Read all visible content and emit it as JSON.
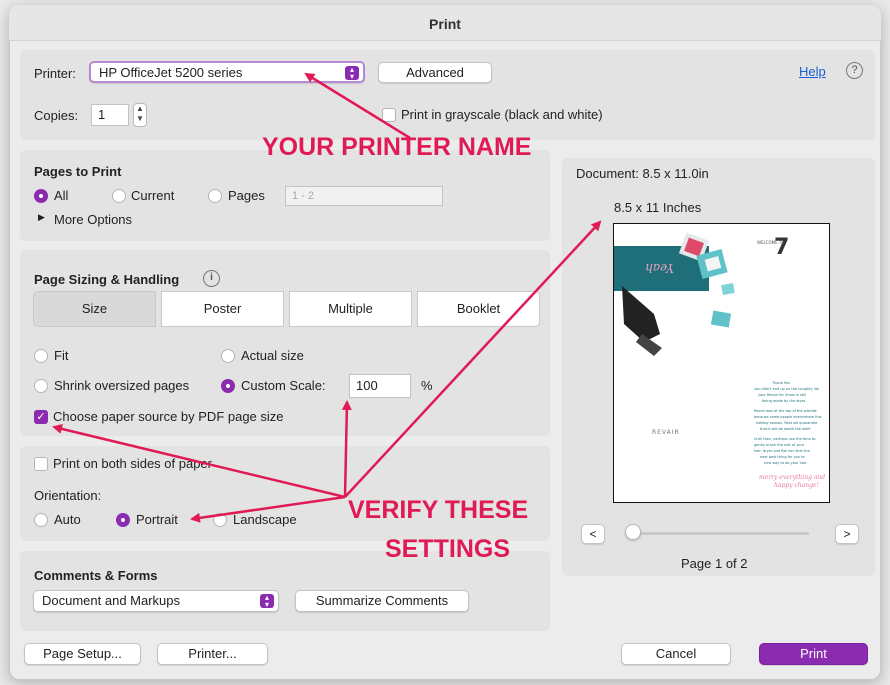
{
  "window": {
    "title": "Print"
  },
  "printer": {
    "label": "Printer:",
    "selected": "HP OfficeJet 5200 series",
    "advanced_label": "Advanced",
    "help_label": "Help",
    "help_icon": "?"
  },
  "copies": {
    "label": "Copies:",
    "value": "1",
    "grayscale_label": "Print in grayscale (black and white)",
    "grayscale_checked": false
  },
  "pages_to_print": {
    "title": "Pages to Print",
    "all_label": "All",
    "current_label": "Current",
    "pages_label": "Pages",
    "pages_placeholder": "1 - 2",
    "selected": "All",
    "more_options_label": "More Options"
  },
  "page_sizing": {
    "title": "Page Sizing & Handling",
    "info_icon": "i",
    "tabs": [
      "Size",
      "Poster",
      "Multiple",
      "Booklet"
    ],
    "selected_tab": "Size",
    "fit_label": "Fit",
    "actual_size_label": "Actual size",
    "shrink_label": "Shrink oversized pages",
    "custom_scale_label": "Custom Scale:",
    "custom_scale_value": "100",
    "percent_label": "%",
    "selected_option": "Custom Scale",
    "paper_source_label": "Choose paper source by PDF page size",
    "paper_source_checked": true
  },
  "duplex": {
    "both_sides_label": "Print on both sides of paper",
    "both_sides_checked": false,
    "orientation_label": "Orientation:",
    "auto_label": "Auto",
    "portrait_label": "Portrait",
    "landscape_label": "Landscape",
    "selected": "Portrait"
  },
  "comments_forms": {
    "title": "Comments & Forms",
    "selected": "Document and Markups",
    "summarize_label": "Summarize Comments"
  },
  "preview": {
    "document_label": "Document: 8.5 x 11.0in",
    "paper_label": "8.5 x 11 Inches",
    "prev_label": "<",
    "next_label": ">",
    "page_indicator": "Page 1 of 2",
    "slider_fraction": 0.0,
    "logo_text": "REVAIR"
  },
  "footer": {
    "page_setup_label": "Page Setup...",
    "printer_label": "Printer...",
    "cancel_label": "Cancel",
    "print_label": "Print"
  },
  "annotations": {
    "printer_name": "YOUR PRINTER NAME",
    "verify_line1": "VERIFY THESE",
    "verify_line2": "SETTINGS",
    "color": "#e01a55"
  },
  "colors": {
    "accent": "#8a2bb0",
    "help_link": "#1a5fd6"
  }
}
